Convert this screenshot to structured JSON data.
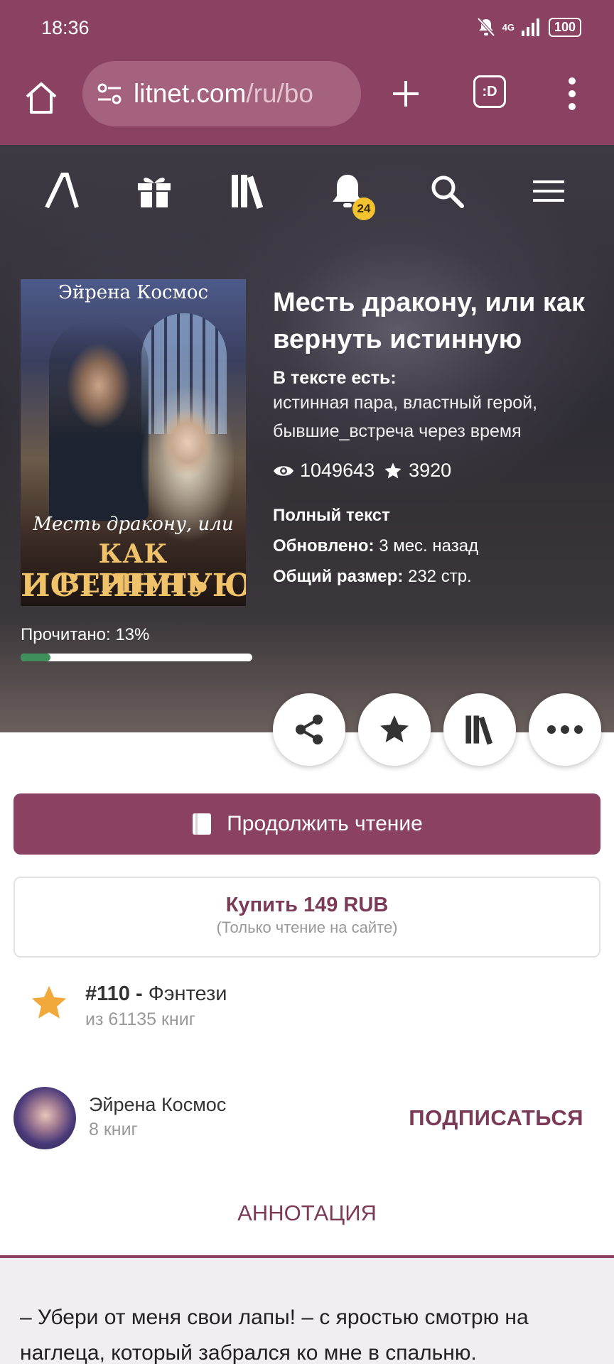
{
  "status_bar": {
    "time": "18:36",
    "network": "4G",
    "battery": "100"
  },
  "browser": {
    "url_host": "litnet.com",
    "url_path": "/ru/bo",
    "tabs_label": ":D"
  },
  "site_nav": {
    "notification_count": "24",
    "icons": [
      "logo-icon",
      "gift-icon",
      "library-icon",
      "bell-icon",
      "search-icon",
      "menu-icon"
    ]
  },
  "book": {
    "cover_author": "Эйрена Космос",
    "cover_script": "Месть дракону, или",
    "cover_title_line1": "КАК ВЕРНУТЬ",
    "cover_title_line2": "ИСТИННУЮ",
    "title": "Месть дракону, или как вернуть истинную",
    "tags_label": "В тексте есть:",
    "tags": "истинная пара, властный герой, бывшие_встреча через время",
    "views": "1049643",
    "likes": "3920",
    "status": "Полный текст",
    "updated_label": "Обновлено:",
    "updated_value": "3 мес. назад",
    "size_label": "Общий размер:",
    "size_value": "232 стр.",
    "read_label": "Прочитано: 13%",
    "read_progress": 0.13
  },
  "actions": {
    "continue_label": "Продолжить чтение",
    "buy_label": "Купить 149 RUB",
    "buy_note": "(Только чтение на сайте)"
  },
  "rank": {
    "position": "#110 -",
    "genre": "Фэнтези",
    "total": "из 61135 книг"
  },
  "author": {
    "name": "Эйрена Космос",
    "books": "8 книг",
    "subscribe_label": "ПОДПИСАТЬСЯ"
  },
  "tabs": {
    "annotation_label": "АННОТАЦИЯ"
  },
  "annotation": {
    "text": "– Убери от меня свои лапы! – с яростью смотрю на наглеца, который забрался ко мне в спальню."
  },
  "colors": {
    "brand": "#8b4262",
    "brand_text": "#7a3a58",
    "progress": "#3f8f5a",
    "star": "#f2a93b",
    "badge": "#f2c32f"
  }
}
